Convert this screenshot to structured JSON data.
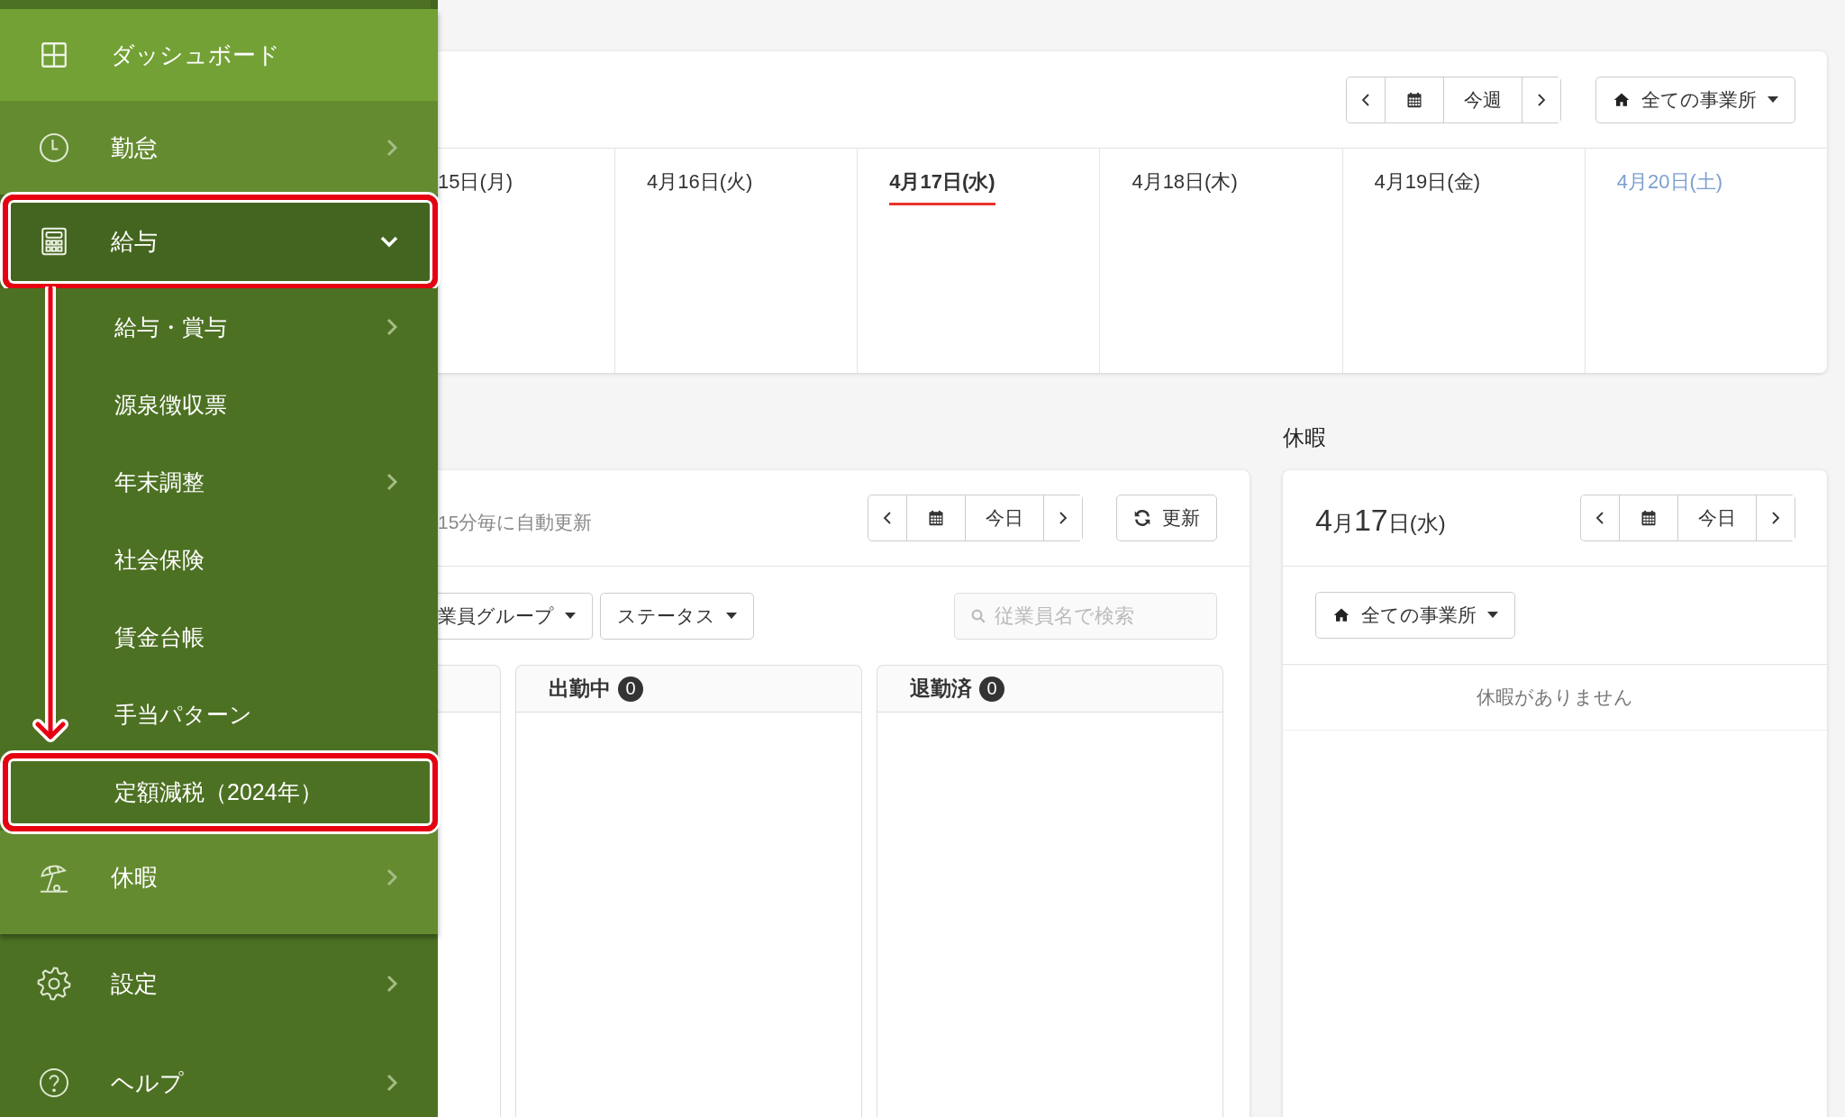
{
  "sidebar": {
    "groups": [
      {
        "items": [
          {
            "label": "ダッシュボード",
            "selected": true,
            "expandable": false,
            "expanded": false,
            "highlighted": false
          },
          {
            "label": "勤怠",
            "selected": false,
            "expandable": true,
            "expanded": false,
            "highlighted": false
          },
          {
            "label": "給与",
            "selected": false,
            "expandable": true,
            "expanded": true,
            "highlighted": true,
            "children": [
              {
                "label": "給与・賞与",
                "selected": false,
                "expandable": true,
                "highlighted": false
              },
              {
                "label": "源泉徴収票",
                "selected": false,
                "expandable": false,
                "highlighted": false
              },
              {
                "label": "年末調整",
                "selected": false,
                "expandable": true,
                "highlighted": false
              },
              {
                "label": "社会保険",
                "selected": false,
                "expandable": false,
                "highlighted": false
              },
              {
                "label": "賃金台帳",
                "selected": false,
                "expandable": false,
                "highlighted": false
              },
              {
                "label": "手当パターン",
                "selected": false,
                "expandable": false,
                "highlighted": false
              },
              {
                "label": "定額減税（2024年）",
                "selected": false,
                "expandable": false,
                "highlighted": true
              }
            ]
          },
          {
            "label": "休暇",
            "selected": false,
            "expandable": true,
            "expanded": false,
            "highlighted": false
          }
        ]
      },
      {
        "items": [
          {
            "label": "設定",
            "selected": false,
            "expandable": true,
            "expanded": false,
            "highlighted": false
          },
          {
            "label": "ヘルプ",
            "selected": false,
            "expandable": true,
            "expanded": false,
            "highlighted": false
          }
        ]
      }
    ]
  },
  "week_view": {
    "period_button": "今週",
    "office_filter": "全ての事業所",
    "days": [
      {
        "label": "15日(月)",
        "kind": "weekday",
        "selected": false
      },
      {
        "label": "4月16日(火)",
        "kind": "weekday",
        "selected": false
      },
      {
        "label": "4月17日(水)",
        "kind": "weekday",
        "selected": true
      },
      {
        "label": "4月18日(木)",
        "kind": "weekday",
        "selected": false
      },
      {
        "label": "4月19日(金)",
        "kind": "weekday",
        "selected": false
      },
      {
        "label": "4月20日(土)",
        "kind": "saturday",
        "selected": false
      }
    ]
  },
  "attendance": {
    "auto_refresh": "15分毎に自動更新",
    "today_button": "今日",
    "refresh_button": "更新",
    "filters": [
      "業員グループ",
      "ステータス"
    ],
    "search": {
      "placeholder": "従業員名で検索"
    },
    "columns": [
      {
        "kind": "partial"
      },
      {
        "kind": "status",
        "title": "出勤中",
        "count": "0"
      },
      {
        "kind": "status",
        "title": "退勤済",
        "count": "0"
      }
    ]
  },
  "leave": {
    "heading": "休暇",
    "date_parts": [
      {
        "text": "4",
        "kind": "number"
      },
      {
        "text": "月",
        "kind": "unit"
      },
      {
        "text": "17",
        "kind": "number"
      },
      {
        "text": "日(水)",
        "kind": "unit"
      }
    ],
    "today_button": "今日",
    "office_filter": "全ての事業所",
    "empty_message": "休暇がありません"
  }
}
